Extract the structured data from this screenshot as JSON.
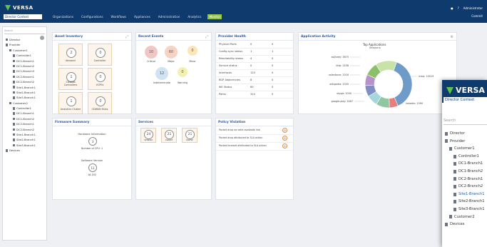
{
  "header": {
    "logo_text": "VERSA",
    "context_label": "Director Context",
    "nav": [
      "Organizations",
      "Configurations",
      "Workflows",
      "Appliances",
      "Administration",
      "Analytics",
      "Monitor"
    ],
    "active_nav": "Monitor",
    "user": "Administrator",
    "commit": "Commit"
  },
  "sidebar": {
    "search_placeholder": "Search",
    "tree": [
      "Director",
      "Provider",
      "Customer1",
      "Controller1",
      "DC1-Branch1",
      "DC1-Branch2",
      "DC1-Branch3",
      "DC2-Branch1",
      "DC2-Branch2",
      "Site1-Branch1",
      "Site2-Branch1",
      "Site3-Branch1",
      "Customer2",
      "Controller1",
      "DC1-Branch1",
      "DC1-Branch2",
      "DC2-Branch1",
      "DC2-Branch2",
      "Site1-Branch1",
      "Site2-Branch1",
      "Site3-Branch1",
      "Devices"
    ]
  },
  "asset_inventory": {
    "title": "Asset Inventory",
    "tiles": [
      {
        "value": "2",
        "label": "Versanni"
      },
      {
        "value": "0",
        "label": "Controller"
      },
      {
        "value": "1",
        "label": "CDWAN Controllers"
      },
      {
        "value": "0",
        "label": "VCPEs"
      },
      {
        "value": "1",
        "label": "Analytics Cluster"
      },
      {
        "value": "0",
        "label": "CDWAN Hubs"
      }
    ]
  },
  "recent_events": {
    "title": "Recent Events",
    "items": [
      {
        "value": "10",
        "label": "Critical",
        "color": "#f3c6c6"
      },
      {
        "value": "60",
        "label": "Major",
        "color": "#f7d3c4"
      },
      {
        "value": "0",
        "label": "Minor",
        "color": "#fbe6b8"
      },
      {
        "value": "12",
        "label": "Indeterminate",
        "color": "#cfe3f3"
      },
      {
        "value": "0",
        "label": "Warning",
        "color": "#f4f0b0"
      }
    ]
  },
  "provider_health": {
    "title": "Provider Health",
    "rows": [
      {
        "name": "Physical Ports",
        "a": "0",
        "b": "0"
      },
      {
        "name": "Config sync status",
        "a": "1",
        "b": "1"
      },
      {
        "name": "Reachability status",
        "a": "4",
        "b": "0"
      },
      {
        "name": "Service status",
        "a": "0",
        "b": "0"
      },
      {
        "name": "Interfaces",
        "a": "120",
        "b": "0"
      },
      {
        "name": "BGP Adjacencies",
        "a": "8",
        "b": "0"
      },
      {
        "name": "IKE Status",
        "a": "60",
        "b": "0"
      },
      {
        "name": "Paths",
        "a": "310",
        "b": "0"
      }
    ]
  },
  "application_activity": {
    "title": "Application Activity",
    "chart_title": "Top Applications",
    "chart_subtitle": "Sessions",
    "labels": [
      "ssl(tele): 3875",
      "http: 2438",
      "salesforce: 2016",
      "wikipedia: 2035",
      "skype: 2030",
      "google-play: 2467",
      "icmp: 10019",
      "linkedin: 1590"
    ]
  },
  "chart_data": {
    "type": "pie",
    "title": "Top Applications",
    "subtitle": "Sessions",
    "categories": [
      "icmp",
      "linkedin",
      "google-play",
      "skype",
      "wikipedia",
      "salesforce",
      "http",
      "ssl(tele)"
    ],
    "values": [
      10019,
      1590,
      2467,
      2030,
      2035,
      2016,
      2438,
      3875
    ],
    "colors": [
      "#6e9bc8",
      "#e77e7e",
      "#8fc7a0",
      "#a4d6dc",
      "#7f8fc2",
      "#b794c7",
      "#8bbf6a",
      "#c9e3a6"
    ]
  },
  "firmware_summary": {
    "title": "Firmware Summary",
    "hardware_label": "Hardware Information",
    "hardware_value": "3",
    "hardware_sub": "Number of CPU: 1",
    "software_label": "Software Version",
    "software_value": "11",
    "software_sub": "16.1R2"
  },
  "services": {
    "title": "Services",
    "items": [
      {
        "value": "24",
        "label": "SDWAN"
      },
      {
        "value": "21",
        "label": "CGNAT"
      },
      {
        "value": "21",
        "label": "NGFW"
      }
    ]
  },
  "policy_violation": {
    "title": "Policy Violation",
    "rows": [
      {
        "text": "Packet drop no valid available link",
        "count": "0"
      },
      {
        "text": "Packet drop attributed to SLA action",
        "count": "0"
      },
      {
        "text": "Packet forward attributed to SLA action",
        "count": "0"
      }
    ]
  },
  "popup": {
    "logo_text": "VERSA",
    "context_label": "Director Context",
    "search_placeholder": "Search",
    "tree": [
      "Director",
      "Provider",
      "Customer1",
      "Controller1",
      "DC1-Branch1",
      "DC1-Branch2",
      "DC2-Branch1",
      "DC2-Branch2",
      "Site1-Branch1",
      "Site2-Branch1",
      "Site3-Branch1",
      "Customer2",
      "Devices"
    ]
  }
}
